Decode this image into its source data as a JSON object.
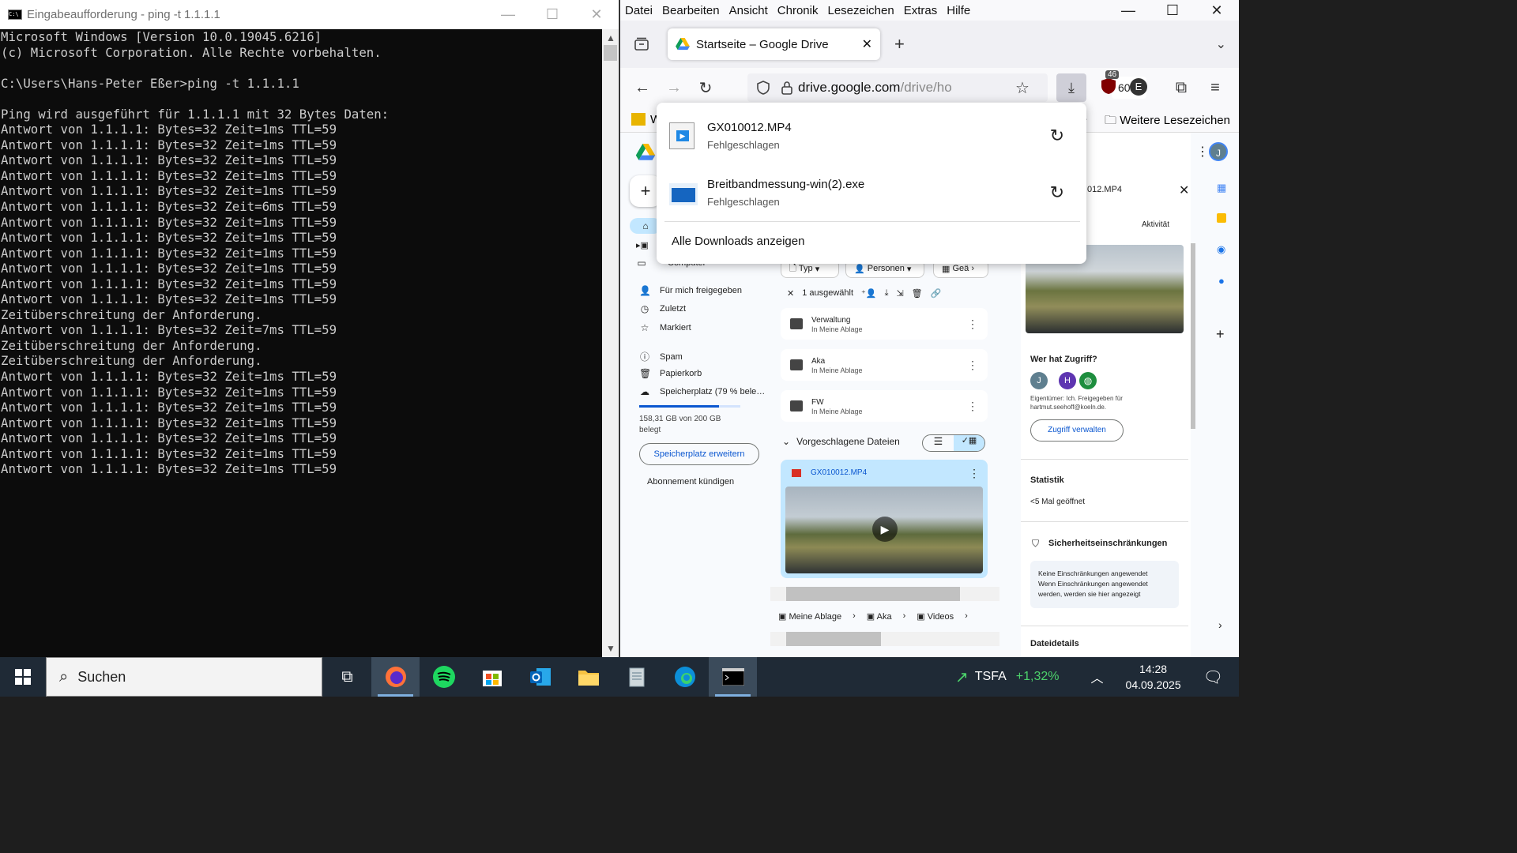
{
  "cmd": {
    "title": "Eingabeaufforderung - ping  -t 1.1.1.1",
    "lines": [
      "Microsoft Windows [Version 10.0.19045.6216]",
      "(c) Microsoft Corporation. Alle Rechte vorbehalten.",
      "",
      "C:\\Users\\Hans-Peter Eßer>ping -t 1.1.1.1",
      "",
      "Ping wird ausgeführt für 1.1.1.1 mit 32 Bytes Daten:",
      "Antwort von 1.1.1.1: Bytes=32 Zeit=1ms TTL=59",
      "Antwort von 1.1.1.1: Bytes=32 Zeit=1ms TTL=59",
      "Antwort von 1.1.1.1: Bytes=32 Zeit=1ms TTL=59",
      "Antwort von 1.1.1.1: Bytes=32 Zeit=1ms TTL=59",
      "Antwort von 1.1.1.1: Bytes=32 Zeit=1ms TTL=59",
      "Antwort von 1.1.1.1: Bytes=32 Zeit=6ms TTL=59",
      "Antwort von 1.1.1.1: Bytes=32 Zeit=1ms TTL=59",
      "Antwort von 1.1.1.1: Bytes=32 Zeit=1ms TTL=59",
      "Antwort von 1.1.1.1: Bytes=32 Zeit=1ms TTL=59",
      "Antwort von 1.1.1.1: Bytes=32 Zeit=1ms TTL=59",
      "Antwort von 1.1.1.1: Bytes=32 Zeit=1ms TTL=59",
      "Antwort von 1.1.1.1: Bytes=32 Zeit=1ms TTL=59",
      "Zeitüberschreitung der Anforderung.",
      "Antwort von 1.1.1.1: Bytes=32 Zeit=7ms TTL=59",
      "Zeitüberschreitung der Anforderung.",
      "Zeitüberschreitung der Anforderung.",
      "Antwort von 1.1.1.1: Bytes=32 Zeit=1ms TTL=59",
      "Antwort von 1.1.1.1: Bytes=32 Zeit=1ms TTL=59",
      "Antwort von 1.1.1.1: Bytes=32 Zeit=1ms TTL=59",
      "Antwort von 1.1.1.1: Bytes=32 Zeit=1ms TTL=59",
      "Antwort von 1.1.1.1: Bytes=32 Zeit=1ms TTL=59",
      "Antwort von 1.1.1.1: Bytes=32 Zeit=1ms TTL=59",
      "Antwort von 1.1.1.1: Bytes=32 Zeit=1ms TTL=59"
    ]
  },
  "browser": {
    "menu": [
      "Datei",
      "Bearbeiten",
      "Ansicht",
      "Chronik",
      "Lesezeichen",
      "Extras",
      "Hilfe"
    ],
    "tab_title": "Startseite – Google Drive",
    "url_host": "drive.google.com",
    "url_path": "/drive/ho",
    "zoom": "60%",
    "ubo_badge": "46",
    "bookmark_left": "W",
    "bookmark_more": "Weitere Lesezeichen",
    "profile_letter": "E"
  },
  "downloads": {
    "items": [
      {
        "name": "GX010012.MP4",
        "status": "Fehlgeschlagen"
      },
      {
        "name": "Breitbandmessung-win(2).exe",
        "status": "Fehlgeschlagen"
      }
    ],
    "show_all": "Alle Downloads anzeigen"
  },
  "drive": {
    "computer_label": "Computer",
    "nav": [
      "Für mich freigegeben",
      "Zuletzt",
      "Markiert",
      "Spam",
      "Papierkorb",
      "Speicherplatz (79 % bele…"
    ],
    "storage_text_1": "158,31 GB von 200 GB",
    "storage_text_2": "belegt",
    "storage_fraction": 0.79,
    "storage_button": "Speicherplatz erweitern",
    "cancel_sub": "Abonnement kündigen",
    "filters": [
      "Typ",
      "Personen",
      "Geä"
    ],
    "selected": "1 ausgewählt",
    "folders": [
      {
        "name": "Verwaltung",
        "loc": "In Meine Ablage"
      },
      {
        "name": "Aka",
        "loc": "In Meine Ablage"
      },
      {
        "name": "FW",
        "loc": "In Meine Ablage"
      }
    ],
    "suggested_header": "Vorgeschlagene Dateien",
    "file_card_name": "GX010012.MP4",
    "breadcrumb": [
      "Meine Ablage",
      "Aka",
      "Videos"
    ],
    "details": {
      "title_partial": "012.MP4",
      "tab_activity": "Aktivität",
      "access_header": "Wer hat Zugriff?",
      "avatars": [
        "J",
        "H"
      ],
      "owner_text_1": "Eigentümer: Ich. Freigegeben für",
      "owner_text_2": "hartmut.seehoff@koeln.de.",
      "manage_access": "Zugriff verwalten",
      "stats_header": "Statistik",
      "stats_value": "<5 Mal geöffnet",
      "security_header": "Sicherheitseinschränkungen",
      "security_text_1": "Keine Einschränkungen angewendet",
      "security_text_2": "Wenn Einschränkungen angewendet",
      "security_text_3": "werden, werden sie hier angezeigt",
      "file_details": "Dateidetails"
    }
  },
  "taskbar": {
    "search": "Suchen",
    "stock_name": "TSFA",
    "stock_change": "+1,32%",
    "time": "14:28",
    "date": "04.09.2025"
  },
  "colors": {
    "drive_blue": "#0b57d0",
    "stock_green": "#4cd26b",
    "cmd_text": "#cccccc"
  }
}
